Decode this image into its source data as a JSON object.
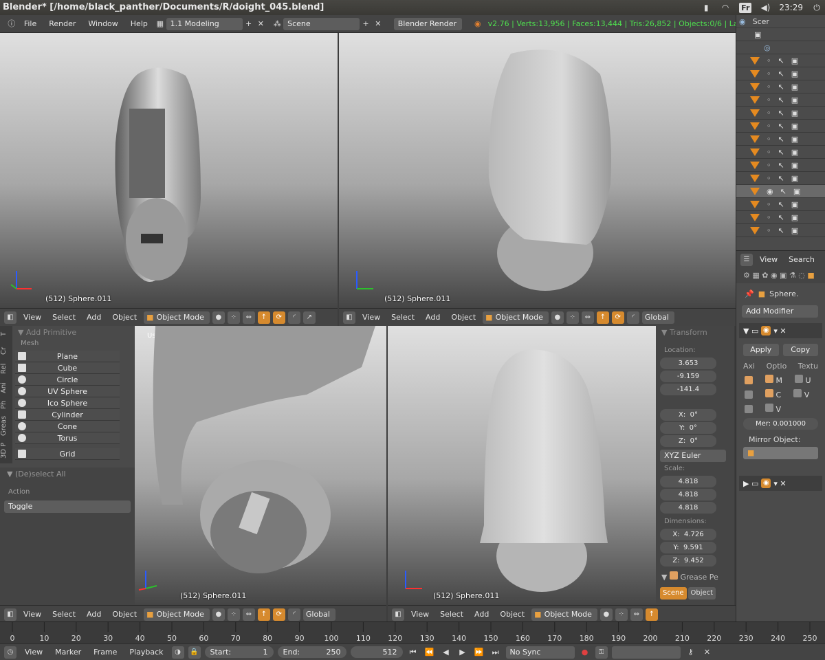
{
  "titlebar": {
    "title": "Blender* [/home/black_panther/Documents/R/doight_045.blend]",
    "lang": "Fr",
    "time": "23:29"
  },
  "infobar": {
    "menus": [
      "File",
      "Render",
      "Window",
      "Help"
    ],
    "layout": "1.1 Modeling",
    "scene": "Scene",
    "engine": "Blender Render",
    "stats": "v2.76 | Verts:13,956 | Faces:13,444 | Tris:26,852 | Objects:0/6 | La"
  },
  "viewport": {
    "label": "(512) Sphere.011",
    "user_persp": "User Persp",
    "menus": [
      "View",
      "Select",
      "Add",
      "Object"
    ],
    "mode": "Object Mode",
    "orientation": "Global"
  },
  "toolshelf": {
    "tabs": [
      "T",
      "Cr",
      "Rel",
      "Ani",
      "Ph",
      "Greas",
      "3D P"
    ],
    "panel_title": "Add Primitive",
    "section": "Mesh",
    "items": [
      "Plane",
      "Cube",
      "Circle",
      "UV Sphere",
      "Ico Sphere",
      "Cylinder",
      "Cone",
      "Torus"
    ],
    "grid": "Grid",
    "op_title": "(De)select All",
    "action_label": "Action",
    "action_value": "Toggle"
  },
  "npanel": {
    "title": "Transform",
    "location_label": "Location:",
    "location": [
      "3.653",
      "-9.159",
      "-141.4"
    ],
    "rot_x": "X:",
    "rot_y": "Y:",
    "rot_z": "Z:",
    "rot_val": "0°",
    "rotation_mode": "XYZ Euler",
    "scale_label": "Scale:",
    "scale": [
      "4.818",
      "4.818",
      "4.818"
    ],
    "dims_label": "Dimensions:",
    "dims_x": "X:",
    "dims_y": "Y:",
    "dims_z": "Z:",
    "dims": [
      "4.726",
      "9.591",
      "9.452"
    ],
    "grease": "Grease Pe",
    "tab_scene": "Scene",
    "tab_object": "Object"
  },
  "outliner": {
    "root": "Scer",
    "footer": [
      "View",
      "Search"
    ]
  },
  "properties": {
    "object": "Sphere.",
    "add_modifier": "Add Modifier",
    "apply": "Apply",
    "copy": "Copy",
    "cols": [
      "Axi",
      "Optio",
      "Textu"
    ],
    "opt_m": "M",
    "opt_c": "C",
    "opt_v": "V",
    "tex_u": "U",
    "tex_v": "V",
    "merge": "Mer: 0.001000",
    "mirror_object": "Mirror Object:"
  },
  "timeline": {
    "ticks": [
      "0",
      "10",
      "20",
      "30",
      "40",
      "50",
      "60",
      "70",
      "80",
      "90",
      "100",
      "110",
      "120",
      "130",
      "140",
      "150",
      "160",
      "170",
      "180",
      "190",
      "200",
      "210",
      "220",
      "230",
      "240",
      "250"
    ],
    "menus": [
      "View",
      "Marker",
      "Frame",
      "Playback"
    ],
    "start_label": "Start:",
    "start": "1",
    "end_label": "End:",
    "end": "250",
    "current": "512",
    "sync": "No Sync"
  }
}
